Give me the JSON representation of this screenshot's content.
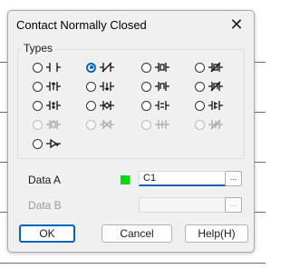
{
  "dialog": {
    "title": "Contact Normally Closed",
    "close_glyph": "✕"
  },
  "types_group": {
    "label": "Types",
    "options": [
      {
        "row": 0,
        "col": 0,
        "symbol": "no-contact-icon",
        "checked": false,
        "enabled": true
      },
      {
        "row": 0,
        "col": 1,
        "symbol": "nc-contact-icon",
        "checked": true,
        "enabled": true
      },
      {
        "row": 0,
        "col": 2,
        "symbol": "box-contact-icon",
        "checked": false,
        "enabled": true
      },
      {
        "row": 0,
        "col": 3,
        "symbol": "box-slash-contact-icon",
        "checked": false,
        "enabled": true
      },
      {
        "row": 1,
        "col": 0,
        "symbol": "rising-edge-contact-icon",
        "checked": false,
        "enabled": true
      },
      {
        "row": 1,
        "col": 1,
        "symbol": "falling-edge-contact-icon",
        "checked": false,
        "enabled": true
      },
      {
        "row": 1,
        "col": 2,
        "symbol": "pulse-contact-icon",
        "checked": false,
        "enabled": true
      },
      {
        "row": 1,
        "col": 3,
        "symbol": "pulse-slash-contact-icon",
        "checked": false,
        "enabled": true
      },
      {
        "row": 2,
        "col": 0,
        "symbol": "up-arrow-contact-icon",
        "checked": false,
        "enabled": true
      },
      {
        "row": 2,
        "col": 1,
        "symbol": "down-arrow-contact-icon",
        "checked": false,
        "enabled": true
      },
      {
        "row": 2,
        "col": 2,
        "symbol": "double-bar-contact-icon",
        "checked": false,
        "enabled": true
      },
      {
        "row": 2,
        "col": 3,
        "symbol": "double-bar-alt-contact-icon",
        "checked": false,
        "enabled": true
      },
      {
        "row": 3,
        "col": 0,
        "symbol": "box-arrow-contact-icon",
        "checked": false,
        "enabled": false
      },
      {
        "row": 3,
        "col": 1,
        "symbol": "arrow-contact-icon",
        "checked": false,
        "enabled": false
      },
      {
        "row": 3,
        "col": 2,
        "symbol": "cross-contact-icon",
        "checked": false,
        "enabled": false
      },
      {
        "row": 3,
        "col": 3,
        "symbol": "cross-alt-contact-icon",
        "checked": false,
        "enabled": false
      },
      {
        "row": 4,
        "col": 0,
        "symbol": "invert-contact-icon",
        "checked": false,
        "enabled": true
      }
    ]
  },
  "data_a": {
    "label": "Data A",
    "swatch_color": "#00dc00",
    "value": "C1",
    "browse_label": "..."
  },
  "data_b": {
    "label": "Data B",
    "value": "",
    "browse_label": "..."
  },
  "buttons": {
    "ok": "OK",
    "cancel": "Cancel",
    "help": "Help(H)"
  }
}
